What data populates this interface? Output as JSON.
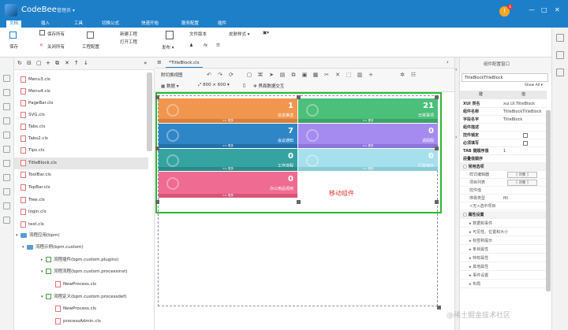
{
  "app": {
    "title": "CodeBee",
    "user_role": "管理员",
    "notification_count": "4"
  },
  "ribbon_tabs": [
    "文档",
    "插入",
    "工具",
    "切换公式",
    "快速开始",
    "服务配置",
    "插件"
  ],
  "ribbon": {
    "save": "保存",
    "save_all": "保存所有",
    "close_all": "关闭所有",
    "project_config": "工程配置",
    "new_project": "新建工程",
    "open_project": "打开工程",
    "publish": "发布",
    "file_version": "文件版本",
    "skin_style": "皮肤样式"
  },
  "tree": {
    "items": [
      {
        "label": "Menu3.cls",
        "type": "file"
      },
      {
        "label": "Menu4.cls",
        "type": "file"
      },
      {
        "label": "PageBar.cls",
        "type": "file"
      },
      {
        "label": "SVG.cls",
        "type": "file"
      },
      {
        "label": "Tabs.cls",
        "type": "file"
      },
      {
        "label": "Tabs2.cls",
        "type": "file"
      },
      {
        "label": "Tips.cls",
        "type": "file"
      },
      {
        "label": "TitleBlock.cls",
        "type": "file",
        "selected": true
      },
      {
        "label": "ToolBar.cls",
        "type": "file"
      },
      {
        "label": "TopBar.cls",
        "type": "file"
      },
      {
        "label": "Tree.cls",
        "type": "file"
      },
      {
        "label": "login.cls",
        "type": "file"
      },
      {
        "label": "test.cls",
        "type": "file"
      },
      {
        "label": "流程应用(bpm)",
        "type": "folder"
      },
      {
        "label": "流程示例(bpm.custom)",
        "type": "folder"
      },
      {
        "label": "流程插件(bpm.custom.plugins)",
        "type": "pkg"
      },
      {
        "label": "流程流程(bpm.custom.processinst)",
        "type": "pkg"
      },
      {
        "label": "NewProcess.cls",
        "type": "file"
      },
      {
        "label": "流程定义(bpm.custom.processdef)",
        "type": "pkg"
      },
      {
        "label": "NewProcess.cls",
        "type": "file"
      },
      {
        "label": "processAdmin.cls",
        "type": "file"
      }
    ]
  },
  "editor": {
    "tab": "*TitleBlock.cls",
    "toolbar": {
      "switch_view": "附切换视图",
      "data": "数据",
      "size": "800 × 600",
      "interface_interact": "界面数据交互"
    },
    "move_label": "移动组件",
    "tiles": [
      {
        "num": "1",
        "label": "信息推送",
        "more": ">> 更多",
        "color": "#f0964f"
      },
      {
        "num": "21",
        "label": "日常事项",
        "more": ">> 更多",
        "color": "#4cbf7a"
      },
      {
        "num": "7",
        "label": "会议通知",
        "more": ">> 更多",
        "color": "#2f86c6"
      },
      {
        "num": "0",
        "label": "请假假",
        "more": ">> 更多",
        "color": "#a58bef"
      },
      {
        "num": "0",
        "label": "工作流程",
        "more": ">> 更多",
        "color": "#35a4a1"
      },
      {
        "num": "0",
        "label": "行政待办",
        "more": ">> 更多",
        "color": "#a5e0ec"
      },
      {
        "num": "0",
        "label": "办公用品领用",
        "more": ">> 更多",
        "color": "#ef6b91"
      }
    ]
  },
  "props": {
    "panel_title": "组件配置窗口",
    "component_name": "TitleBlockTitleBlock",
    "show_all": "Show All",
    "col_key": "键",
    "col_value": "值",
    "rows": [
      {
        "k": "XUI 类名",
        "v": "xui.UI.TitleBlock"
      },
      {
        "k": "组件名称",
        "v": "TitleBlockTitleBlock"
      },
      {
        "k": "字段名字",
        "v": "TitleBlock"
      },
      {
        "k": "组件描述",
        "v": ""
      },
      {
        "k": "控件锁定",
        "v": ""
      },
      {
        "k": "必须填写",
        "v": ""
      },
      {
        "k": "TAB 键顺序值",
        "v": "1"
      },
      {
        "k": "层叠值顺序",
        "v": ""
      }
    ],
    "section_common": "□ 常用选项",
    "common_rows": [
      {
        "k": "样式编辑器",
        "v": "[ 对象 ]"
      },
      {
        "k": "项目列表",
        "v": "[ 对象 ]"
      },
      {
        "k": "控件值",
        "v": ""
      },
      {
        "k": "停靠类型",
        "v": "fill"
      },
      {
        "k": "<无>选中项目",
        "v": ""
      }
    ],
    "section_props": "□ 属性设置",
    "prop_groups": [
      "数据和事件",
      "可见性、位置和大小",
      "标签和提示",
      "条目属性",
      "特有属性",
      "其他属性",
      "事件设置",
      "布局"
    ]
  },
  "watermark": "@稀土掘金技术社区"
}
